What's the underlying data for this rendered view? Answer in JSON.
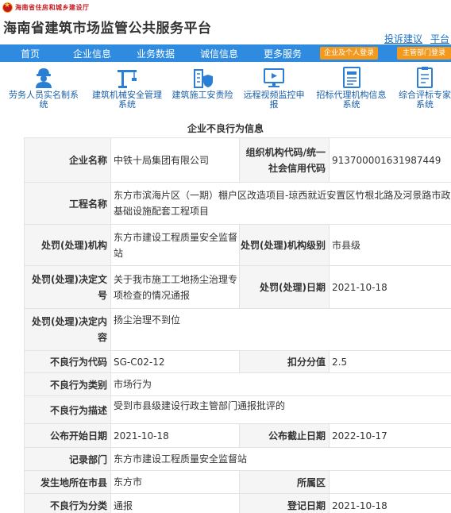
{
  "header": {
    "dept_name": "海南省住房和城乡建设厅",
    "site_title": "海南省建筑市场监管公共服务平台",
    "links": [
      "投诉建议",
      "平台"
    ]
  },
  "nav": {
    "items": [
      "首页",
      "企业信息",
      "业务数据",
      "诚信信息",
      "更多服务"
    ],
    "login_enterprise": "企业及个人登录",
    "login_admin": "主管部门登录"
  },
  "quick_links": [
    {
      "line1": "劳务人员实名制系",
      "line2": "统",
      "icon": "worker-icon"
    },
    {
      "line1": "建筑机械安全管理",
      "line2": "系统",
      "icon": "crane-icon"
    },
    {
      "line1": "建筑施工安责险",
      "line2": "",
      "icon": "shield-building-icon"
    },
    {
      "line1": "远程视频监控申",
      "line2": "报",
      "icon": "monitor-video-icon"
    },
    {
      "line1": "招标代理机构信息",
      "line2": "系统",
      "icon": "document-list-icon"
    },
    {
      "line1": "综合评标专家",
      "line2": "系统",
      "icon": "clipboard-icon"
    }
  ],
  "section_title": "企业不良行为信息",
  "record": {
    "company_label": "企业名称",
    "company": "中铁十局集团有限公司",
    "code_label": "组织机构代码/统一社会信用代码",
    "code": "913700001631987449",
    "project_label": "工程名称",
    "project": "东方市滨海片区（一期）棚户区改造项目-琼西就近安置区竹根北路及河景路市政基础设施配套工程项目",
    "org_label": "处罚(处理)机构",
    "org": "东方市建设工程质量安全监督站",
    "level_label": "处罚(处理)机构级别",
    "level": "市县级",
    "doc_label": "处罚(处理)决定文号",
    "doc": "关于我市施工工地扬尘治理专项检查的情况通报",
    "date_label": "处罚(处理)日期",
    "date": "2021-10-18",
    "content_label": "处罚(处理)决定内容",
    "content": "扬尘治理不到位",
    "bcode_label": "不良行为代码",
    "bcode": "SG-C02-12",
    "score_label": "扣分分值",
    "score": "2.5",
    "category_label": "不良行为类别",
    "category": "市场行为",
    "desc_label": "不良行为描述",
    "desc": "受到市县级建设行政主管部门通报批评的",
    "start_label": "公布开始日期",
    "start": "2021-10-18",
    "end_label": "公布截止日期",
    "end": "2022-10-17",
    "dept_label": "记录部门",
    "dept": "东方市建设工程质量安全监督站",
    "city_label": "发生地所在市县",
    "city": "东方市",
    "district_label": "所属区",
    "district": "",
    "type_label": "不良行为分类",
    "type": "通报",
    "reg_label": "登记日期",
    "reg": "2021-10-18"
  }
}
